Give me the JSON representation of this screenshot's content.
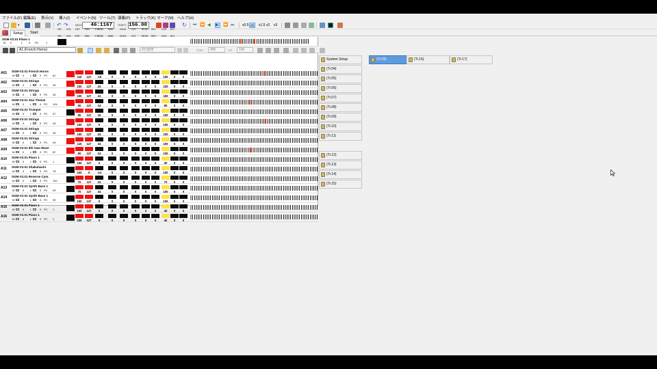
{
  "menu": [
    "ファイル(F)",
    "編集(E)",
    "表示(V)",
    "挿入(I)",
    "イベント(N)",
    "ツール(T)",
    "演奏(P)",
    "トラック(K)",
    "マーク(M)",
    "ヘルプ(H)"
  ],
  "transport": {
    "measure_label": "MEAS",
    "measure": "46:1167",
    "tempo_label": "TEMPO",
    "tempo": "156.00",
    "speeds": [
      "x0.5",
      "x1",
      "x1.5",
      "x2",
      "x3"
    ]
  },
  "tabs": [
    "Setup",
    "Start"
  ],
  "port": {
    "voice": "SGM-V2.01 Piano 1",
    "m_label": "M",
    "m": "0",
    "l_label": "L",
    "l": "0",
    "pc_label": "PC",
    "pc": "1"
  },
  "trackbar": {
    "selected_track": "A1 (French Horns)",
    "note_length": "8分音符",
    "gate_label": "Gate",
    "gate": "480",
    "vel_label": "Vel",
    "vel": "100"
  },
  "header_labels": [
    "VEL",
    "VOL",
    "EXP",
    "PAN",
    "P.BEND",
    "MOD",
    "HOLD",
    "CUT",
    "RESO",
    "REV",
    "CHO",
    "DLY"
  ],
  "tracks": [
    {
      "id": "A01",
      "voice": "SGM-V2.01 French Horns",
      "m": "0",
      "l": "0",
      "pc": "61",
      "vals": [
        "110",
        "127",
        "-15",
        "0",
        "0",
        "0",
        "0",
        "0",
        "100",
        "0",
        "0"
      ],
      "meter": "red"
    },
    {
      "id": "A02",
      "voice": "SGM-V2.01 Strings",
      "m": "0",
      "l": "0",
      "pc": "49",
      "vals": [
        "100",
        "127",
        "24",
        "0",
        "0",
        "0",
        "0",
        "0",
        "100",
        "0",
        "0"
      ],
      "meter": "red"
    },
    {
      "id": "A03",
      "voice": "SGM-V2.01 Strings",
      "m": "0",
      "l": "0",
      "pc": "49",
      "vals": [
        "100",
        "127",
        "24",
        "0",
        "0",
        "0",
        "0",
        "0",
        "100",
        "0",
        "0"
      ],
      "meter": "red"
    },
    {
      "id": "A04",
      "voice": "SGM-V2.01 Star Theme",
      "m": "0",
      "l": "0",
      "pc": "104",
      "vals": [
        "90",
        "127",
        "24",
        "0",
        "0",
        "0",
        "0",
        "0",
        "80",
        "0",
        "0"
      ],
      "meter": "red"
    },
    {
      "id": "A05",
      "voice": "SGM-V2.01 Trumpet",
      "m": "0",
      "l": "0",
      "pc": "57",
      "vals": [
        "90",
        "127",
        "16",
        "0",
        "0",
        "0",
        "0",
        "0",
        "100",
        "0",
        "0"
      ],
      "meter": "black"
    },
    {
      "id": "A06",
      "voice": "SGM-V2.01 Strings",
      "m": "0",
      "l": "0",
      "pc": "49",
      "vals": [
        "100",
        "127",
        "0",
        "0",
        "0",
        "0",
        "0",
        "0",
        "100",
        "0",
        "0"
      ],
      "meter": "red"
    },
    {
      "id": "A07",
      "voice": "SGM-V2.01 Strings",
      "m": "0",
      "l": "0",
      "pc": "49",
      "vals": [
        "100",
        "127",
        "24",
        "0",
        "0",
        "0",
        "0",
        "0",
        "100",
        "0",
        "0"
      ],
      "meter": "red"
    },
    {
      "id": "A08",
      "voice": "SGM-V2.01 Strings",
      "m": "0",
      "l": "0",
      "pc": "49",
      "vals": [
        "110",
        "127",
        "34",
        "0",
        "0",
        "0",
        "0",
        "0",
        "100",
        "0",
        "0"
      ],
      "meter": "red"
    },
    {
      "id": "A09",
      "voice": "SGM-V2.01 5th Saw Wave",
      "m": "0",
      "l": "0",
      "pc": "87",
      "vals": [
        "90",
        "127",
        "24",
        "0",
        "0",
        "0",
        "0",
        "0",
        "100",
        "0",
        "0"
      ],
      "meter": "red"
    },
    {
      "id": "A10",
      "voice": "SGM-V2.01 Piano 1",
      "m": "0",
      "l": "0",
      "pc": "1",
      "vals": [
        "100",
        "127",
        "0",
        "0",
        "0",
        "0",
        "0",
        "0",
        "40",
        "0",
        "0"
      ],
      "meter": "black"
    },
    {
      "id": "A11",
      "voice": "SGM-V2.01 Shakuhachi",
      "m": "0",
      "l": "0",
      "pc": "78",
      "vals": [
        "100",
        "0",
        "-14",
        "0",
        "0",
        "0",
        "0",
        "0",
        "100",
        "0",
        "0"
      ],
      "meter": "black"
    },
    {
      "id": "A12",
      "voice": "SGM-V2.01 Reverse Cym.",
      "m": "0",
      "l": "0",
      "pc": "120",
      "vals": [
        "70",
        "127",
        "24",
        "0",
        "0",
        "0",
        "0",
        "0",
        "70",
        "0",
        "0"
      ],
      "meter": "black"
    },
    {
      "id": "A13",
      "voice": "SGM-V2.01 Synth Bass 1",
      "m": "0",
      "l": "0",
      "pc": "39",
      "vals": [
        "70",
        "127",
        "34",
        "0",
        "0",
        "0",
        "0",
        "0",
        "100",
        "0",
        "0"
      ],
      "meter": "black"
    },
    {
      "id": "A14",
      "voice": "SGM-V2.01 Synth Bass 1",
      "m": "0",
      "l": "0",
      "pc": "39",
      "vals": [
        "100",
        "127",
        "0",
        "0",
        "0",
        "0",
        "0",
        "0",
        "100",
        "0",
        "0"
      ],
      "meter": "black"
    },
    {
      "id": "A15",
      "voice": "SGM-V2.01 Piano 1",
      "m": "0",
      "l": "0",
      "pc": "1",
      "vals": [
        "100",
        "127",
        "0",
        "0",
        "0",
        "0",
        "0",
        "0",
        "40",
        "0",
        "0"
      ],
      "meter": "black"
    },
    {
      "id": "A16",
      "voice": "SGM-V2.01 Piano 1",
      "m": "0",
      "l": "0",
      "pc": "1",
      "vals": [
        "100",
        "127",
        "0",
        "0",
        "0",
        "0",
        "0",
        "0",
        "40",
        "0",
        "0"
      ],
      "meter": "black"
    }
  ],
  "track_tabs": [
    "System Setup",
    "(Tr.03)",
    "(Tr.16)",
    "(Tr.17)",
    "(Tr.04)",
    "(Tr.05)",
    "(Tr.06)",
    "(Tr.07)",
    "(Tr.08)",
    "(Tr.09)",
    "(Tr.10)",
    "(Tr.11)",
    "(Tr.12)",
    "(Tr.13)",
    "(Tr.14)",
    "(Tr.15)"
  ],
  "selected_track_tab": "(Tr.03)"
}
